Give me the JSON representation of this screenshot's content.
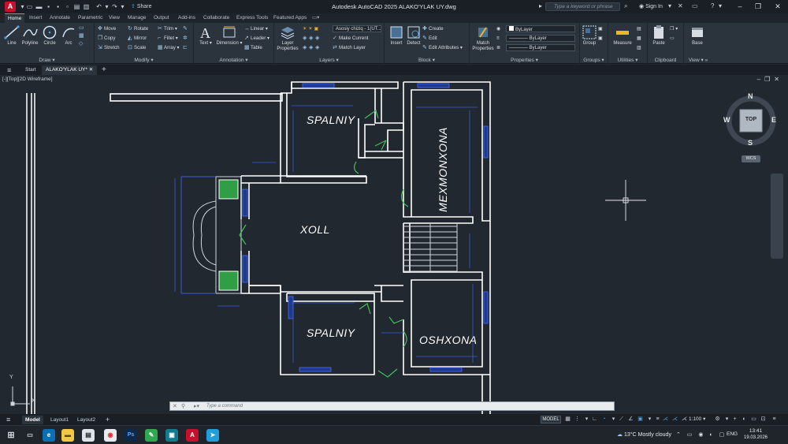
{
  "app": {
    "title": "Autodesk AutoCAD 2025   ALAKO'YLAK UY.dwg",
    "logo_letter": "A",
    "share_label": "Share"
  },
  "search": {
    "placeholder": "Type a keyword or phrase"
  },
  "account": {
    "signin_label": "Sign In"
  },
  "ribbon_tabs": [
    "Home",
    "Insert",
    "Annotate",
    "Parametric",
    "View",
    "Manage",
    "Output",
    "Add-ins",
    "Collaborate",
    "Express Tools",
    "Featured Apps"
  ],
  "ribbon": {
    "draw": {
      "label": "Draw",
      "line": "Line",
      "polyline": "Polyline",
      "circle": "Circle",
      "arc": "Arc"
    },
    "modify": {
      "label": "Modify",
      "move": "Move",
      "rotate": "Rotate",
      "trim": "Trim",
      "copy": "Copy",
      "mirror": "Mirror",
      "fillet": "Fillet",
      "stretch": "Stretch",
      "scale": "Scale",
      "array": "Array"
    },
    "annotation": {
      "label": "Annotation",
      "text": "Text",
      "dimension": "Dimension",
      "linear": "Linear",
      "leader": "Leader",
      "table": "Table"
    },
    "layers": {
      "label": "Layers",
      "layer_properties": "Layer Properties",
      "current_layer": "Asosiy chiziq - 1(UT...",
      "make_current": "Make Current",
      "match_layer": "Match Layer"
    },
    "block": {
      "label": "Block",
      "insert": "Insert",
      "detect": "Detect",
      "create": "Create",
      "edit": "Edit",
      "edit_attributes": "Edit Attributes"
    },
    "properties": {
      "label": "Properties",
      "match_properties": "Match Properties",
      "color": "ByLayer",
      "linetype": "ByLayer",
      "lineweight": "ByLayer"
    },
    "groups": {
      "label": "Groups",
      "group": "Group"
    },
    "utilities": {
      "label": "Utilities",
      "measure": "Measure"
    },
    "clipboard": {
      "label": "Clipboard",
      "paste": "Paste"
    },
    "view": {
      "label": "View",
      "base": "Base"
    }
  },
  "file_tabs": {
    "start": "Start",
    "active": "ALAKO'YLAK UY*"
  },
  "viewport": {
    "label": "[-][Top][2D Wireframe]"
  },
  "rooms": [
    "SPALNIY",
    "MEXMONXONA",
    "XOLL",
    "SPALNIY",
    "OSHXONA"
  ],
  "viewcube": {
    "n": "N",
    "s": "S",
    "e": "E",
    "w": "W",
    "face": "TOP",
    "wcs": "WCS"
  },
  "ucs": {
    "x": "X",
    "y": "Y"
  },
  "command": {
    "placeholder": "Type a command"
  },
  "layout_tabs": [
    "Model",
    "Layout1",
    "Layout2"
  ],
  "status": {
    "model": "MODEL",
    "scale": "1:100"
  },
  "taskbar": {
    "weather": "13°C  Mostly cloudy",
    "lang": "ENG",
    "time": "13:41",
    "date": "19.03.2026"
  },
  "colors": {
    "wall": "#ffffff",
    "dimension": "#3b5bdb",
    "door_swing": "#40c057",
    "window_fill": "#1e3a8a",
    "background": "#212830"
  }
}
